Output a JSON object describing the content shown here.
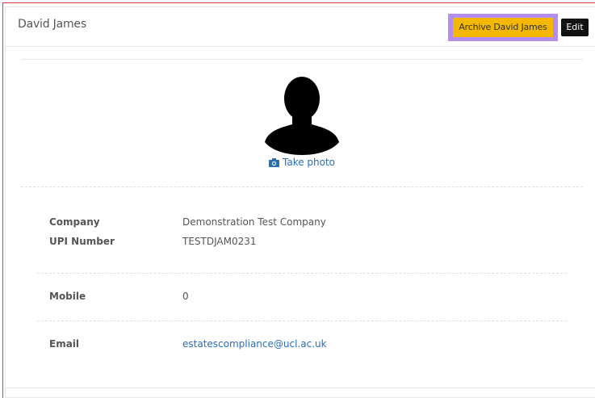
{
  "header": {
    "title": "David James",
    "archive_label": "Archive David James",
    "edit_label": "Edit"
  },
  "profile": {
    "take_photo_label": "Take photo"
  },
  "details": {
    "company_label": "Company",
    "company_value": "Demonstration Test Company",
    "upi_label": "UPI Number",
    "upi_value": "TESTDJAM0231",
    "mobile_label": "Mobile",
    "mobile_value": "0",
    "email_label": "Email",
    "email_value": "estatescompliance@ucl.ac.uk"
  },
  "icons": {
    "avatar": "user-silhouette-icon",
    "camera": "camera-icon"
  },
  "colors": {
    "archive_bg": "#f5b800",
    "archive_highlight": "#b58cf0",
    "edit_bg": "#111111",
    "link": "#2a6db5",
    "frame_border": "#e13a3a"
  }
}
